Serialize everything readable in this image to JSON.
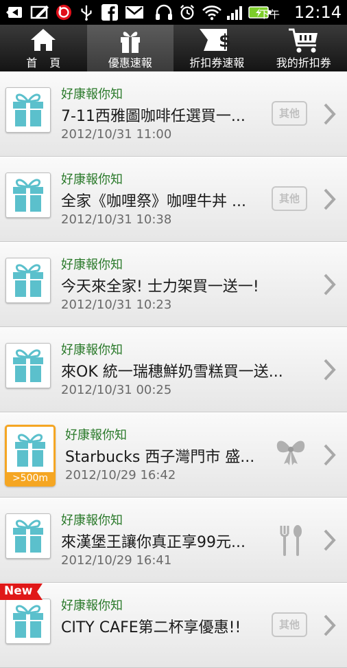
{
  "status_bar": {
    "ampm": "下午",
    "time": "12:14",
    "icons": [
      "back-icon",
      "edit-icon",
      "beats-icon",
      "usb-icon",
      "facebook-icon",
      "gmail-icon",
      "headphones-icon",
      "alarm-icon",
      "wifi-icon",
      "signal-icon",
      "battery-icon"
    ]
  },
  "tabs": [
    {
      "label": "首頁",
      "icon": "home-icon",
      "active": false
    },
    {
      "label": "優惠速報",
      "icon": "gift-icon",
      "active": true
    },
    {
      "label": "折扣券速報",
      "icon": "coupon-icon",
      "active": false
    },
    {
      "label": "我的折扣券",
      "icon": "cart-icon",
      "active": false
    }
  ],
  "colors": {
    "accent_green": "#2b7a2b",
    "gift_teal": "#5bc0cc",
    "distance_orange": "#f5a623",
    "new_red": "#e01818"
  },
  "items": [
    {
      "source": "好康報你知",
      "title": "7-11西雅圖咖啡任選買一...",
      "date": "2012/10/31 11:00",
      "category": "其他",
      "category_icon": "other-badge"
    },
    {
      "source": "好康報你知",
      "title": "全家《咖哩祭》咖哩牛丼 ...",
      "date": "2012/10/31 10:38",
      "category": "其他",
      "category_icon": "other-badge"
    },
    {
      "source": "好康報你知",
      "title": "今天來全家! 士力架買一送一!",
      "date": "2012/10/31 10:23",
      "category": "",
      "category_icon": ""
    },
    {
      "source": "好康報你知",
      "title": "來OK 統一瑞穗鮮奶雪糕買一送...",
      "date": "2012/10/31 00:25",
      "category": "",
      "category_icon": ""
    },
    {
      "source": "好康報你知",
      "title": "Starbucks 西子灣門市 盛...",
      "date": "2012/10/29 16:42",
      "category": "",
      "category_icon": "bow-icon",
      "distance": ">500m"
    },
    {
      "source": "好康報你知",
      "title": "來漢堡王讓你真正享99元...",
      "date": "2012/10/29 16:41",
      "category": "",
      "category_icon": "fork-spoon-icon"
    },
    {
      "source": "好康報你知",
      "title": "CITY CAFE第二杯享優惠!!",
      "date": "",
      "category": "其他",
      "category_icon": "other-badge",
      "new_label": "New"
    }
  ]
}
